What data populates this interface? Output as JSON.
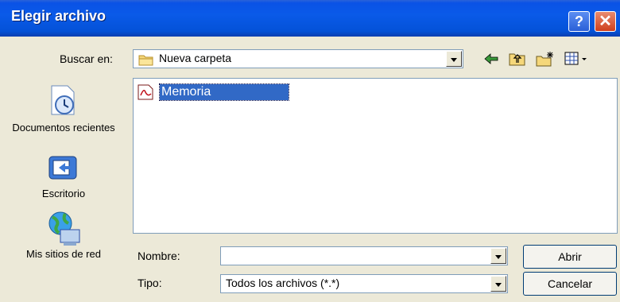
{
  "window": {
    "title": "Elegir archivo",
    "help_glyph": "?",
    "close_glyph": "✕"
  },
  "toolbar": {
    "look_in_label": "Buscar en:",
    "look_in_value": "Nueva carpeta",
    "icons": [
      "back-arrow-icon",
      "up-folder-icon",
      "new-folder-icon",
      "view-menu-icon"
    ]
  },
  "places": [
    {
      "label": "Documentos recientes",
      "icon": "recent-documents-icon"
    },
    {
      "label": "Escritorio",
      "icon": "desktop-icon"
    },
    {
      "label": "Mis sitios de red",
      "icon": "network-places-icon"
    }
  ],
  "files": [
    {
      "name": "Memoria",
      "icon": "pdf-file-icon",
      "selected": true
    }
  ],
  "filename": {
    "label": "Nombre:",
    "value": ""
  },
  "filetype": {
    "label": "Tipo:",
    "value": "Todos los archivos (*.*)"
  },
  "buttons": {
    "open": "Abrir",
    "cancel": "Cancelar"
  },
  "colors": {
    "title_bar": "#0a5ae8",
    "selection": "#3169c6",
    "dialog_bg": "#ece9d8"
  }
}
